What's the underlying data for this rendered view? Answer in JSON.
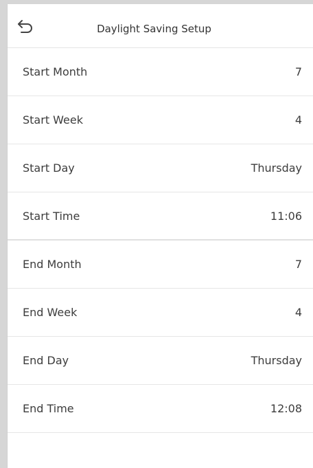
{
  "header": {
    "title": "Daylight Saving Setup",
    "back_icon": "back-arrow-icon"
  },
  "settings": [
    {
      "label": "Start Month",
      "value": "7"
    },
    {
      "label": "Start Week",
      "value": "4"
    },
    {
      "label": "Start Day",
      "value": "Thursday"
    },
    {
      "label": "Start Time",
      "value": "11:06"
    },
    {
      "label": "End Month",
      "value": "7"
    },
    {
      "label": "End Week",
      "value": "4"
    },
    {
      "label": "End Day",
      "value": "Thursday"
    },
    {
      "label": "End Time",
      "value": "12:08"
    }
  ]
}
